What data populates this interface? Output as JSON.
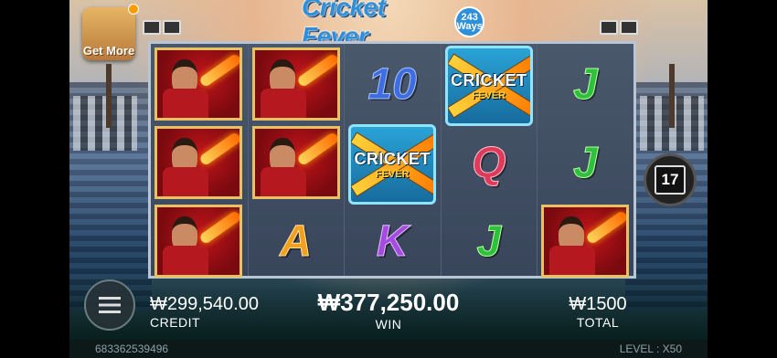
{
  "game": {
    "title": "Cricket Fever",
    "ways_number": "243",
    "ways_label": "Ways"
  },
  "get_more": {
    "label": "Get More"
  },
  "reels": {
    "columns": [
      [
        {
          "symbol": "player"
        },
        {
          "symbol": "player"
        },
        {
          "symbol": "player"
        }
      ],
      [
        {
          "symbol": "player"
        },
        {
          "symbol": "player"
        },
        {
          "symbol": "A"
        }
      ],
      [
        {
          "symbol": "10"
        },
        {
          "symbol": "wild"
        },
        {
          "symbol": "K"
        }
      ],
      [
        {
          "symbol": "wild"
        },
        {
          "symbol": "Q"
        },
        {
          "symbol": "J"
        }
      ],
      [
        {
          "symbol": "J"
        },
        {
          "symbol": "J"
        },
        {
          "symbol": "player"
        }
      ]
    ],
    "wild_text_1": "CRICKET",
    "wild_text_2": "FEVER"
  },
  "spin_counter": "17",
  "credit": {
    "amount": "₩299,540.00",
    "label": "CREDIT"
  },
  "win": {
    "amount": "₩377,250.00",
    "label": "WIN"
  },
  "total": {
    "amount": "₩1500",
    "label": "TOTAL"
  },
  "footer": {
    "id": "683362539496",
    "level_label": "LEVEL :",
    "level_value": "X50"
  }
}
